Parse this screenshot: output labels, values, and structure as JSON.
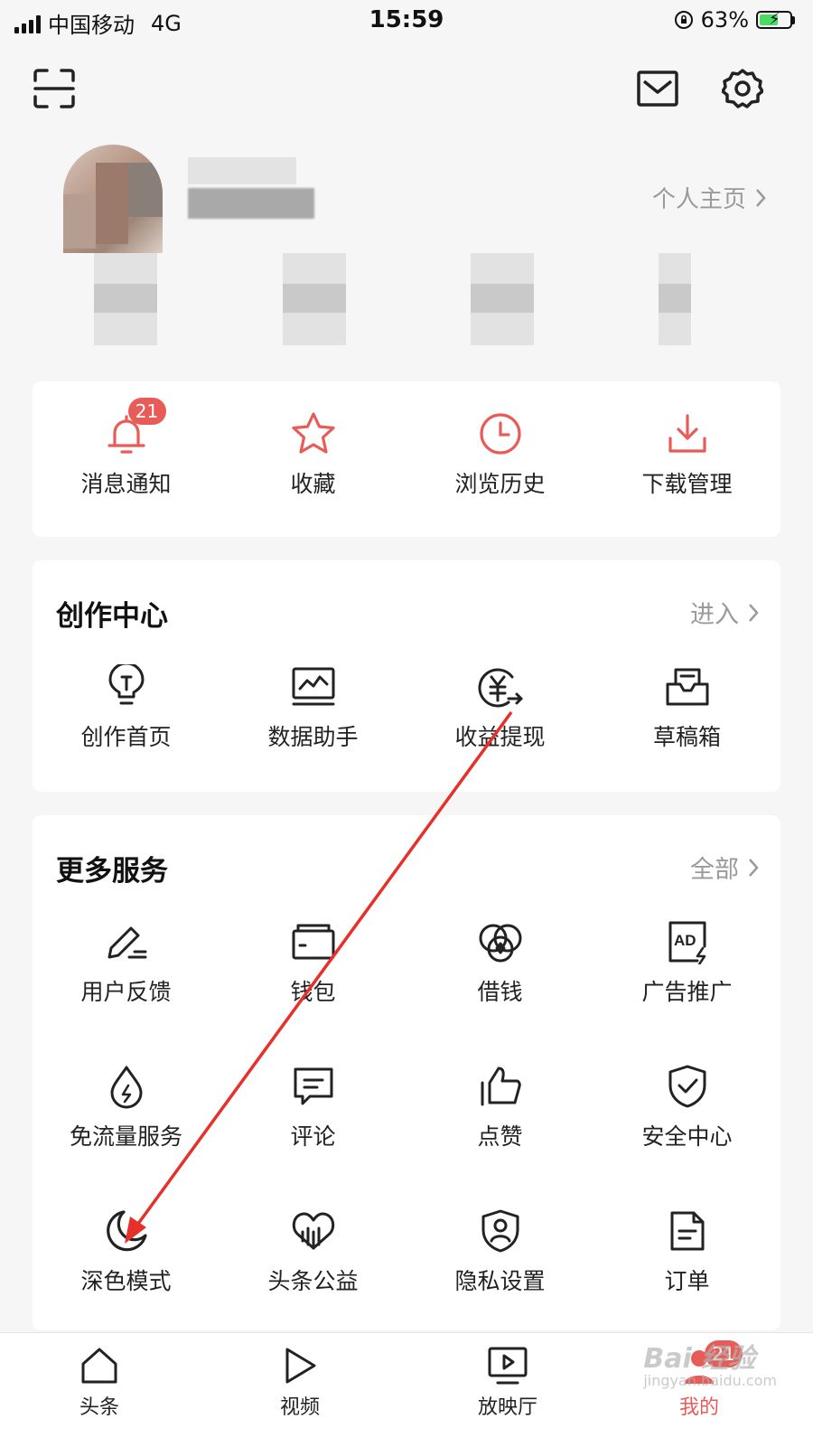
{
  "status_bar": {
    "carrier": "中国移动",
    "network": "4G",
    "time": "15:59",
    "battery_percent": "63%",
    "battery_level": 0.63
  },
  "profile": {
    "homepage_link": "个人主页"
  },
  "quick_actions": [
    {
      "label": "消息通知",
      "icon": "bell-icon",
      "badge": "21"
    },
    {
      "label": "收藏",
      "icon": "star-icon"
    },
    {
      "label": "浏览历史",
      "icon": "clock-icon"
    },
    {
      "label": "下载管理",
      "icon": "download-icon"
    }
  ],
  "creator_center": {
    "title": "创作中心",
    "more": "进入",
    "items": [
      {
        "label": "创作首页",
        "icon": "lightbulb-icon"
      },
      {
        "label": "数据助手",
        "icon": "chart-icon"
      },
      {
        "label": "收益提现",
        "icon": "yuan-withdraw-icon"
      },
      {
        "label": "草稿箱",
        "icon": "drafts-icon"
      }
    ]
  },
  "more_services": {
    "title": "更多服务",
    "more": "全部",
    "items": [
      {
        "label": "用户反馈",
        "icon": "pencil-icon"
      },
      {
        "label": "钱包",
        "icon": "wallet-icon"
      },
      {
        "label": "借钱",
        "icon": "loan-icon"
      },
      {
        "label": "广告推广",
        "icon": "ad-icon"
      },
      {
        "label": "免流量服务",
        "icon": "drop-icon"
      },
      {
        "label": "评论",
        "icon": "comment-icon"
      },
      {
        "label": "点赞",
        "icon": "thumbs-up-icon"
      },
      {
        "label": "安全中心",
        "icon": "shield-check-icon"
      },
      {
        "label": "深色模式",
        "icon": "moon-icon"
      },
      {
        "label": "头条公益",
        "icon": "charity-icon"
      },
      {
        "label": "隐私设置",
        "icon": "privacy-shield-icon"
      },
      {
        "label": "订单",
        "icon": "order-icon"
      }
    ]
  },
  "bottom_nav": [
    {
      "label": "头条",
      "icon": "home-icon"
    },
    {
      "label": "视频",
      "icon": "play-icon"
    },
    {
      "label": "放映厅",
      "icon": "theater-icon"
    },
    {
      "label": "我的",
      "icon": "profile-icon",
      "badge": "21",
      "active": true
    }
  ],
  "colors": {
    "accent": "#e85c58",
    "annotation_arrow": "#e8302a"
  },
  "watermark": {
    "text": "Bai 经验",
    "sub": "jingyan.baidu.com"
  }
}
